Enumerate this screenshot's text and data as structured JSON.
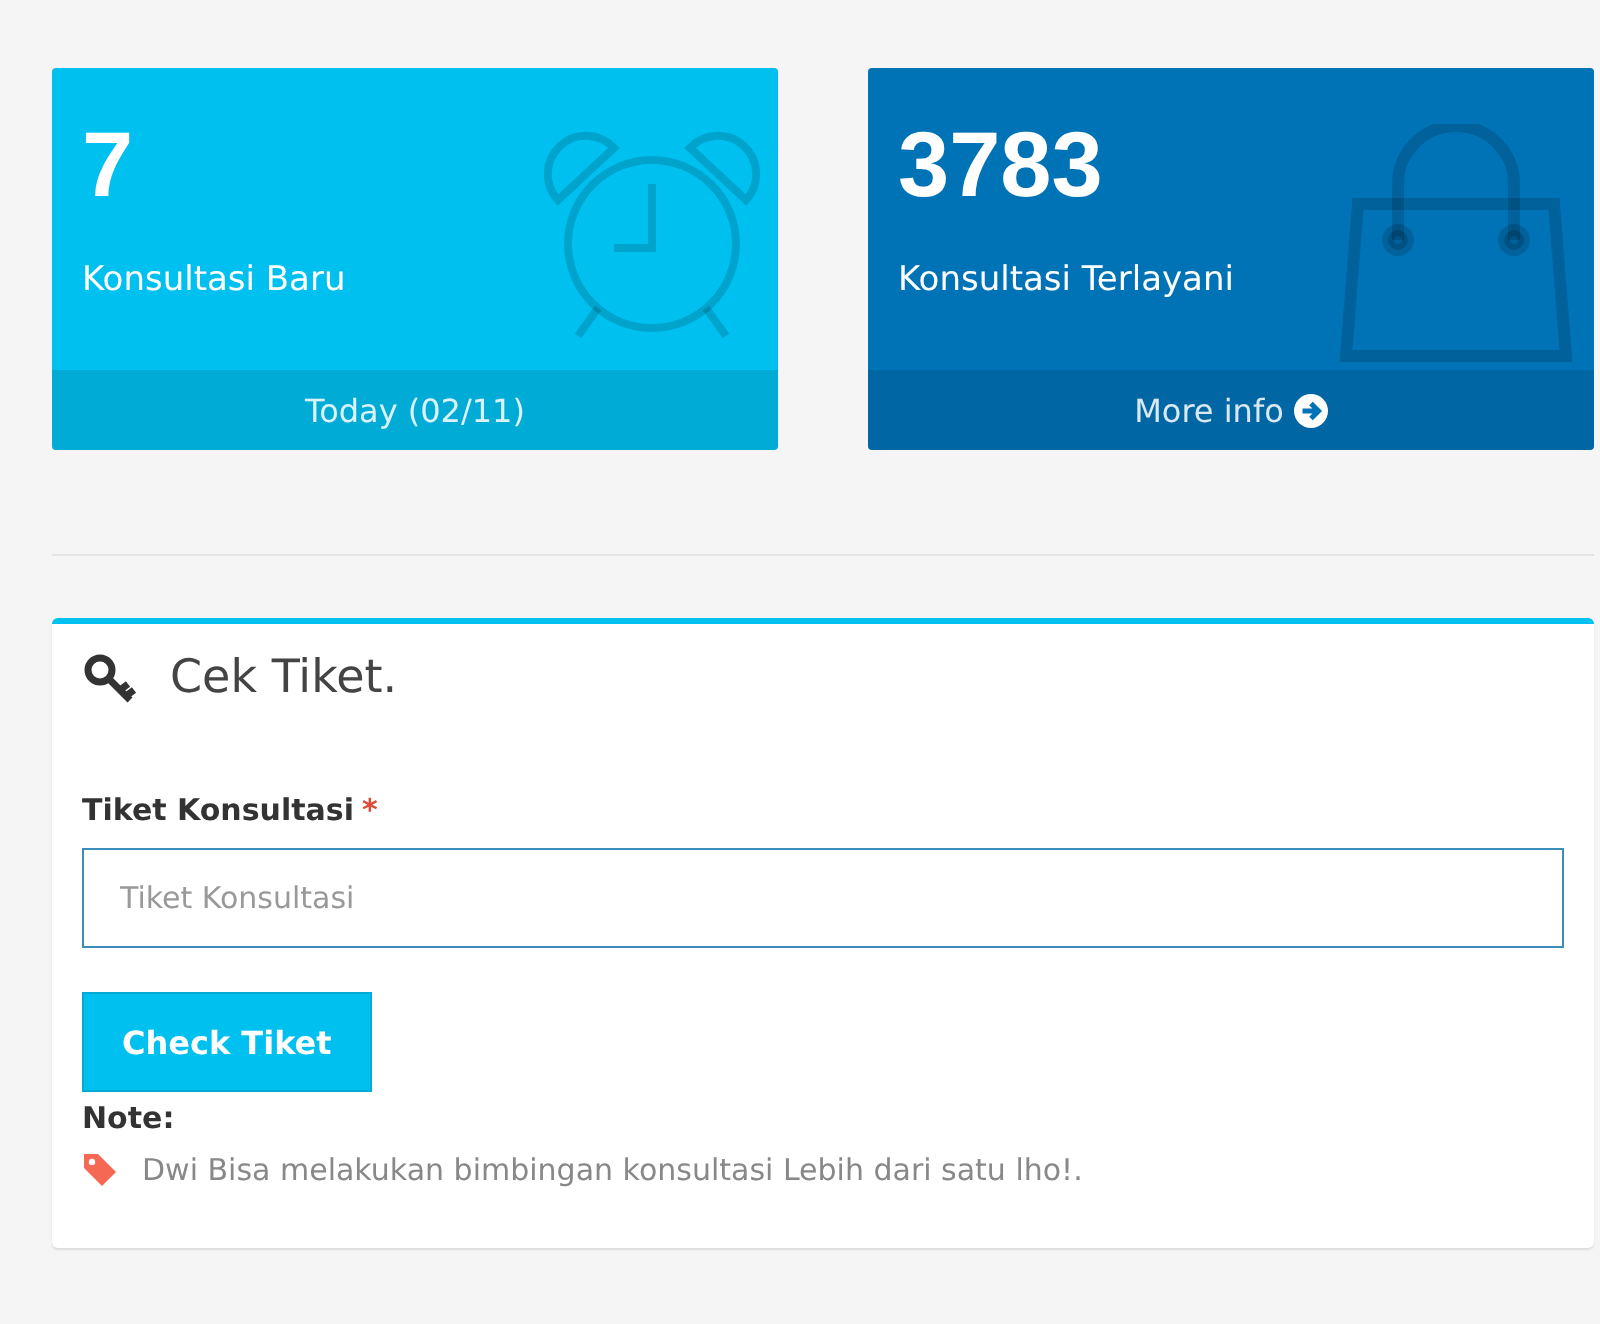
{
  "stats": [
    {
      "number": "7",
      "label": "Konsultasi Baru",
      "footer": "Today (02/11)",
      "color": "#00c0ef"
    },
    {
      "number": "3783",
      "label": "Konsultasi Terlayani",
      "footer": "More info",
      "color": "#0073b7"
    }
  ],
  "box": {
    "title": "Cek Tiket.",
    "field_label": "Tiket Konsultasi",
    "required_mark": "*",
    "placeholder": "Tiket Konsultasi",
    "button": "Check Tiket",
    "note_title": "Note:",
    "note": "Dwi Bisa melakukan bimbingan konsultasi Lebih dari satu lho!."
  }
}
